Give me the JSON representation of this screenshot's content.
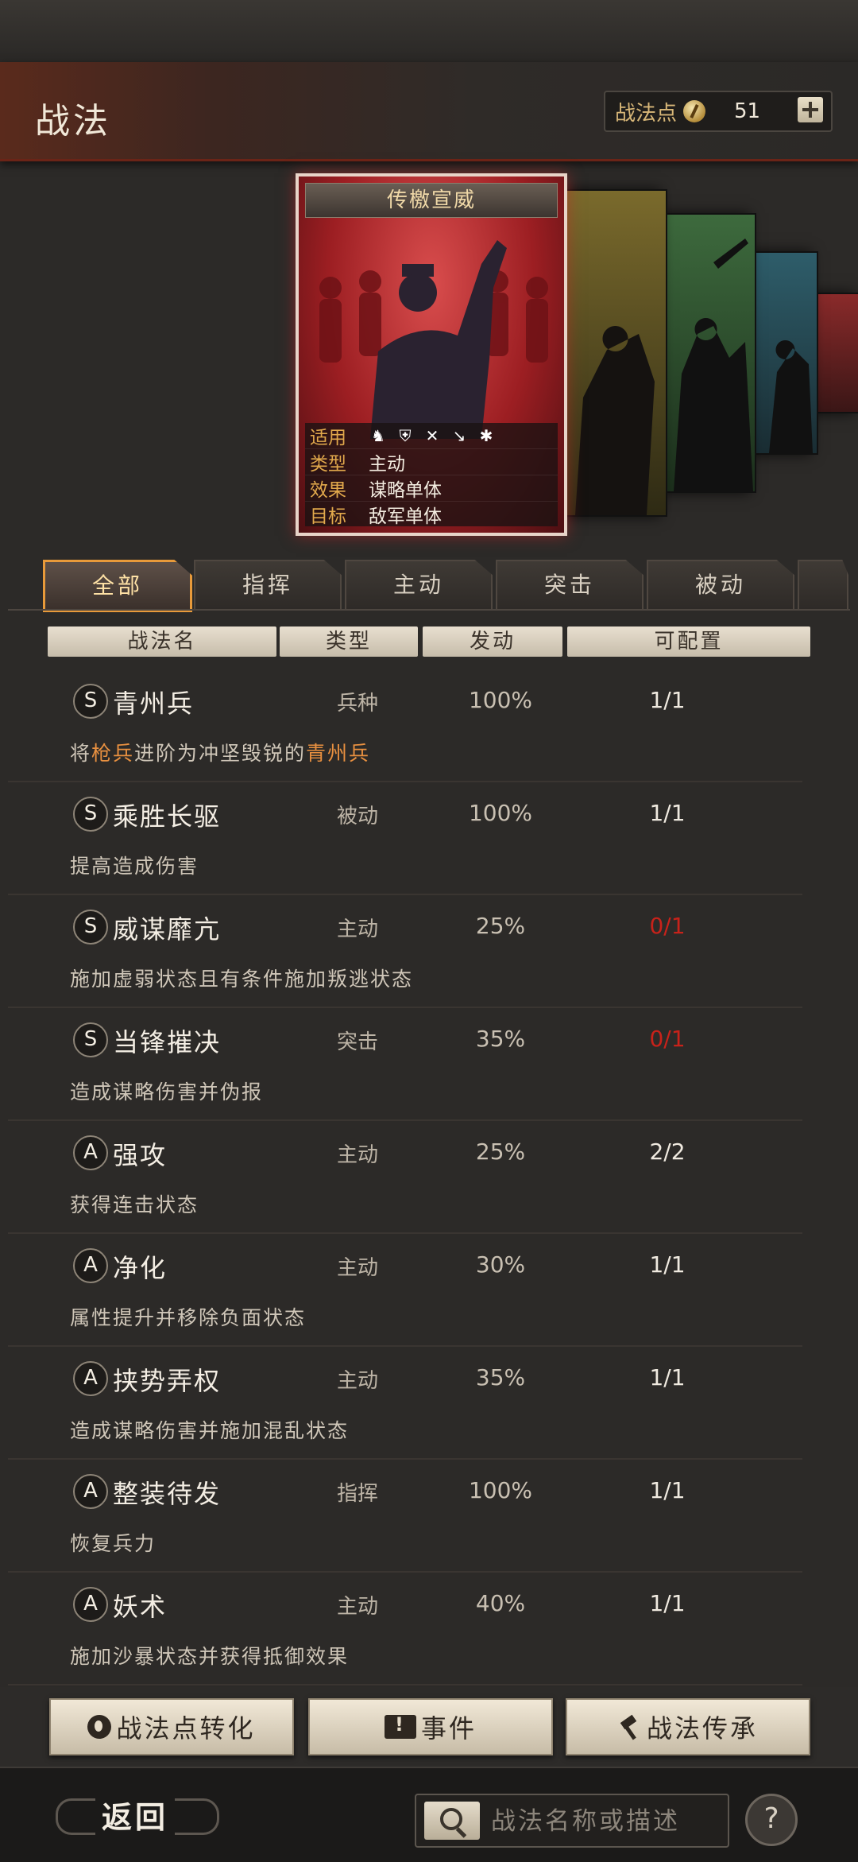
{
  "header": {
    "title": "战法",
    "points_label": "战法点",
    "points_value": "51"
  },
  "featured_card": {
    "name": "传檄宣威",
    "rows": [
      {
        "key": "适用",
        "value": ""
      },
      {
        "key": "类型",
        "value": "主动"
      },
      {
        "key": "效果",
        "value": "谋略单体"
      },
      {
        "key": "目标",
        "value": "敌军单体"
      }
    ],
    "accent_color": "#b01e22"
  },
  "tabs": [
    {
      "label": "全部",
      "active": true
    },
    {
      "label": "指挥",
      "active": false
    },
    {
      "label": "主动",
      "active": false
    },
    {
      "label": "突击",
      "active": false
    },
    {
      "label": "被动",
      "active": false
    }
  ],
  "columns": [
    "战法名",
    "类型",
    "发动",
    "可配置"
  ],
  "skills": [
    {
      "grade": "S",
      "name": "青州兵",
      "type": "兵种",
      "rate": "100%",
      "config": "1/1",
      "config_red": false,
      "desc_parts": [
        "将",
        "枪兵",
        "进阶为冲坚毁锐的",
        "青州兵"
      ]
    },
    {
      "grade": "S",
      "name": "乘胜长驱",
      "type": "被动",
      "rate": "100%",
      "config": "1/1",
      "config_red": false,
      "desc": "提高造成伤害"
    },
    {
      "grade": "S",
      "name": "威谋靡亢",
      "type": "主动",
      "rate": "25%",
      "config": "0/1",
      "config_red": true,
      "desc": "施加虚弱状态且有条件施加叛逃状态"
    },
    {
      "grade": "S",
      "name": "当锋摧决",
      "type": "突击",
      "rate": "35%",
      "config": "0/1",
      "config_red": true,
      "desc": "造成谋略伤害并伪报"
    },
    {
      "grade": "A",
      "name": "强攻",
      "type": "主动",
      "rate": "25%",
      "config": "2/2",
      "config_red": false,
      "desc": "获得连击状态"
    },
    {
      "grade": "A",
      "name": "净化",
      "type": "主动",
      "rate": "30%",
      "config": "1/1",
      "config_red": false,
      "desc": "属性提升并移除负面状态"
    },
    {
      "grade": "A",
      "name": "挟势弄权",
      "type": "主动",
      "rate": "35%",
      "config": "1/1",
      "config_red": false,
      "desc": "造成谋略伤害并施加混乱状态"
    },
    {
      "grade": "A",
      "name": "整装待发",
      "type": "指挥",
      "rate": "100%",
      "config": "1/1",
      "config_red": false,
      "desc": "恢复兵力"
    },
    {
      "grade": "A",
      "name": "妖术",
      "type": "主动",
      "rate": "40%",
      "config": "1/1",
      "config_red": false,
      "desc": "施加沙暴状态并获得抵御效果"
    }
  ],
  "buttons": {
    "convert": "战法点转化",
    "event": "事件",
    "inherit": "战法传承"
  },
  "footer": {
    "back": "返回",
    "search_placeholder": "战法名称或描述",
    "help": "?"
  }
}
